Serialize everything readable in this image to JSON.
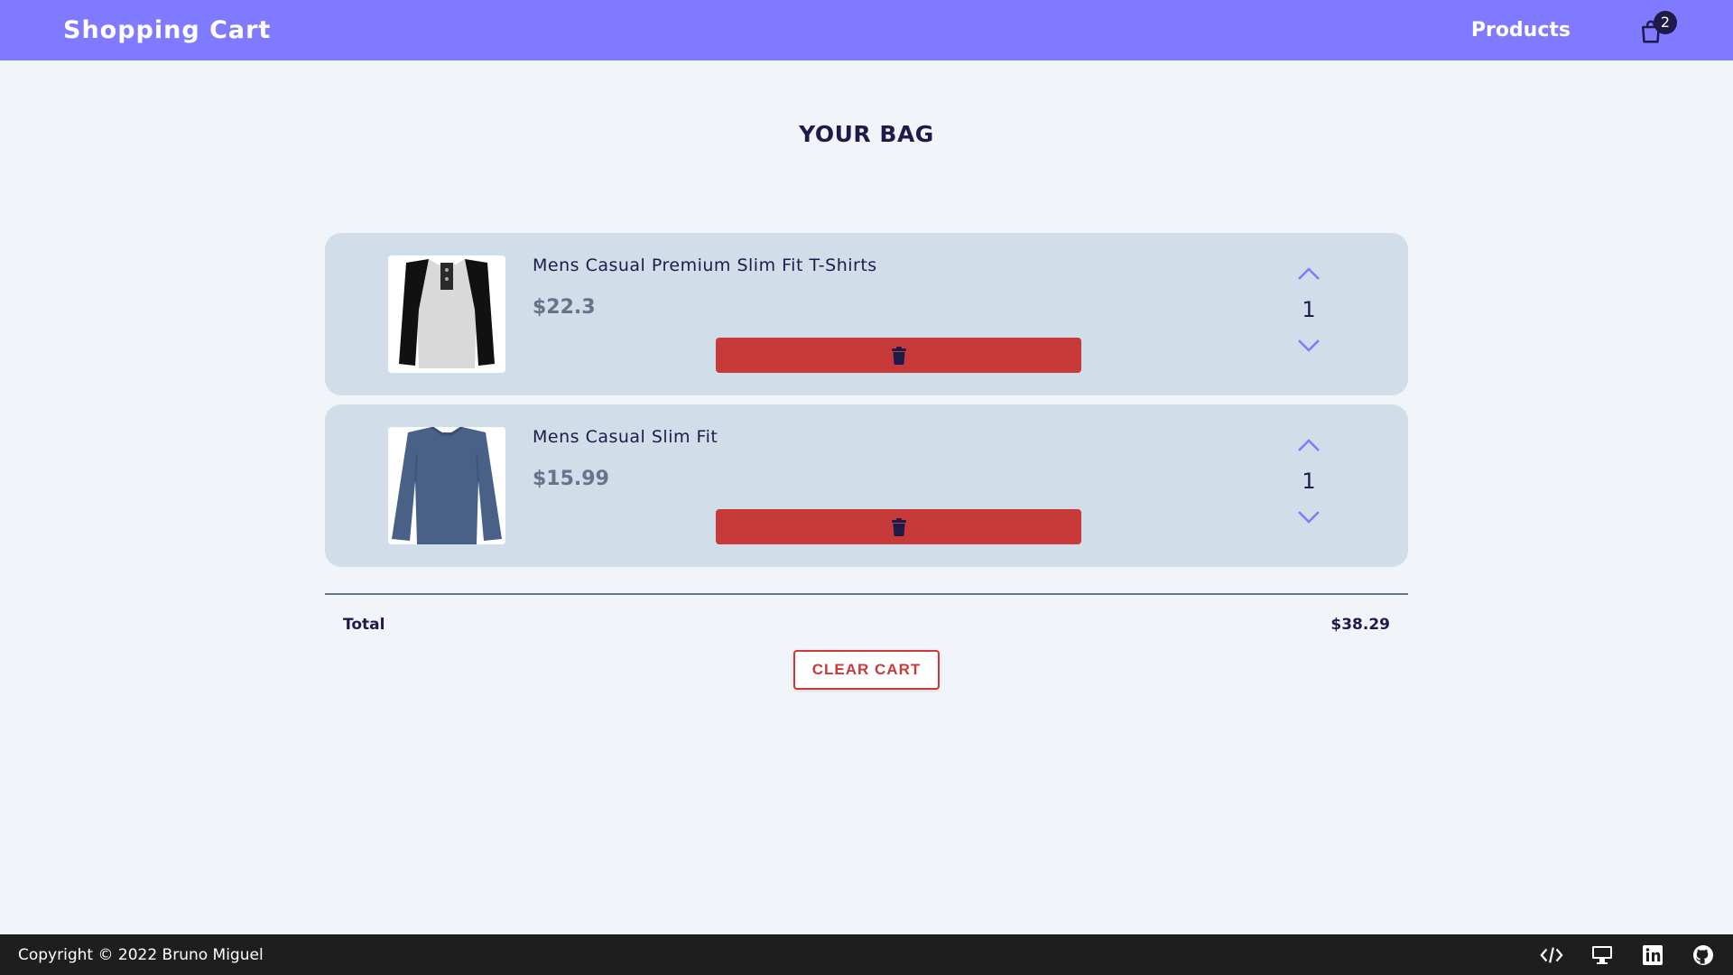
{
  "header": {
    "brand": "Shopping Cart",
    "nav_products": "Products",
    "cart_count": "2",
    "cart_icon": "shopping-bag-icon"
  },
  "main": {
    "title": "YOUR BAG",
    "items": [
      {
        "title": "Mens Casual Premium Slim Fit T-Shirts",
        "price": "$22.3",
        "quantity": "1",
        "image": "raglan-henley-tshirt"
      },
      {
        "title": "Mens Casual Slim Fit",
        "price": "$15.99",
        "quantity": "1",
        "image": "blue-longsleeve-shirt"
      }
    ],
    "total_label": "Total",
    "total_value": "$38.29",
    "clear_label": "CLEAR CART"
  },
  "footer": {
    "copyright": "Copyright © 2022 Bruno Miguel",
    "icons": [
      "code-icon",
      "desktop-icon",
      "linkedin-icon",
      "github-icon"
    ]
  },
  "colors": {
    "header_bg": "#7f7aff",
    "item_bg": "#d1dde9",
    "danger": "#c83939",
    "text_dark": "#1e1b4b",
    "accent": "#7f7aff",
    "footer_bg": "#1e1e1e"
  }
}
